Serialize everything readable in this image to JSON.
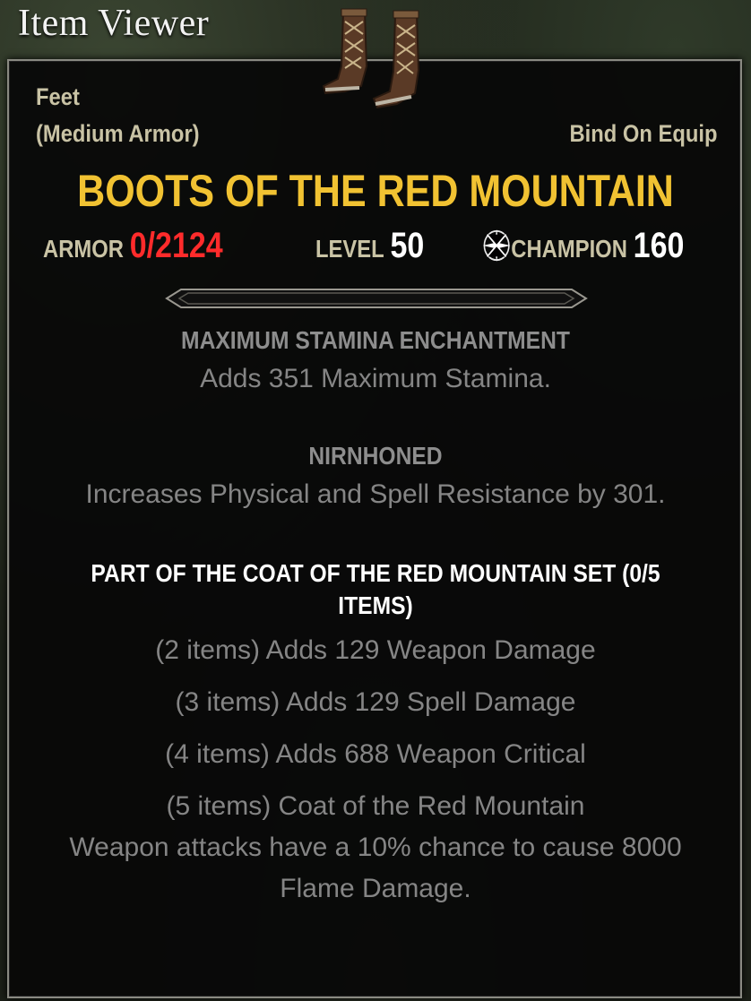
{
  "window": {
    "title": "Item Viewer"
  },
  "item": {
    "slot": "Feet",
    "weight": "(Medium Armor)",
    "bind": "Bind On Equip",
    "name": "BOOTS OF THE RED MOUNTAIN",
    "icon": "leather-boots-icon"
  },
  "stats": {
    "armor_label": "ARMOR",
    "armor_value": "0/2124",
    "level_label": "LEVEL",
    "level_value": "50",
    "champion_icon": "champion-star-icon",
    "champion_label": "CHAMPION",
    "champion_value": "160"
  },
  "enchantment": {
    "title": "MAXIMUM STAMINA ENCHANTMENT",
    "description": "Adds 351 Maximum Stamina."
  },
  "trait": {
    "title": "NIRNHONED",
    "description": "Increases Physical and Spell Resistance by 301."
  },
  "set": {
    "title_line1": "PART OF THE COAT OF THE RED MOUNTAIN SET (0/5",
    "title_line2": "ITEMS)",
    "bonuses": [
      "(2 items) Adds 129 Weapon Damage",
      "(3 items) Adds 129 Spell Damage",
      "(4 items) Adds 688 Weapon Critical",
      "(5 items) Coat of the Red Mountain"
    ],
    "bonus5_desc_line1": "Weapon attacks have a 10% chance to cause 8000",
    "bonus5_desc_line2": "Flame Damage."
  },
  "colors": {
    "item_name": "#f1c232",
    "armor_value": "#ff2b2b",
    "label": "#c9c3a5",
    "muted_text": "#858585"
  }
}
